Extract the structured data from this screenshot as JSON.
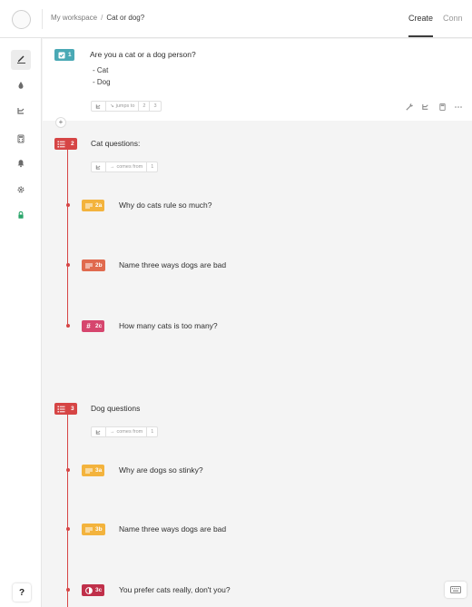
{
  "header": {
    "workspace": "My workspace",
    "separator": "/",
    "form_name": "Cat or dog?",
    "tabs": [
      {
        "label": "Create",
        "active": true
      },
      {
        "label": "Conn",
        "active": false
      }
    ]
  },
  "sidebar": {
    "items": [
      {
        "icon": "pencil-icon",
        "active": true
      },
      {
        "icon": "paint-drop-icon",
        "active": false
      },
      {
        "icon": "logic-branch-icon",
        "active": false
      },
      {
        "icon": "calculator-icon",
        "active": false
      },
      {
        "icon": "bell-icon",
        "active": false
      },
      {
        "icon": "gear-icon",
        "active": false
      },
      {
        "icon": "lock-icon",
        "active": false
      }
    ],
    "help_label": "?"
  },
  "questions": {
    "q1": {
      "number": "1",
      "title": "Are you a cat or a dog person?",
      "choices": [
        "- Cat",
        "- Dog"
      ],
      "logic_label": "jumps to",
      "targets": [
        "2",
        "3"
      ],
      "color": "#4aa9b5"
    },
    "q2": {
      "number": "2",
      "title": "Cat questions:",
      "logic_label": "comes from",
      "source": "1",
      "color": "#d64545",
      "items": [
        {
          "number": "2a",
          "title": "Why do cats rule so much?",
          "color": "#f3b33d"
        },
        {
          "number": "2b",
          "title": "Name three ways dogs are bad",
          "color": "#e06a4e"
        },
        {
          "number": "2c",
          "title": "How many cats is too many?",
          "color": "#d6466e"
        }
      ]
    },
    "q3": {
      "number": "3",
      "title": "Dog questions",
      "logic_label": "comes from",
      "source": "1",
      "color": "#d64545",
      "items": [
        {
          "number": "3a",
          "title": "Why are dogs so stinky?",
          "color": "#f3b33d"
        },
        {
          "number": "3b",
          "title": "Name three ways dogs are bad",
          "color": "#f3b33d"
        },
        {
          "number": "3c",
          "title": "You prefer cats really, don't you?",
          "color": "#c0304a"
        }
      ]
    }
  },
  "add_label": "+"
}
